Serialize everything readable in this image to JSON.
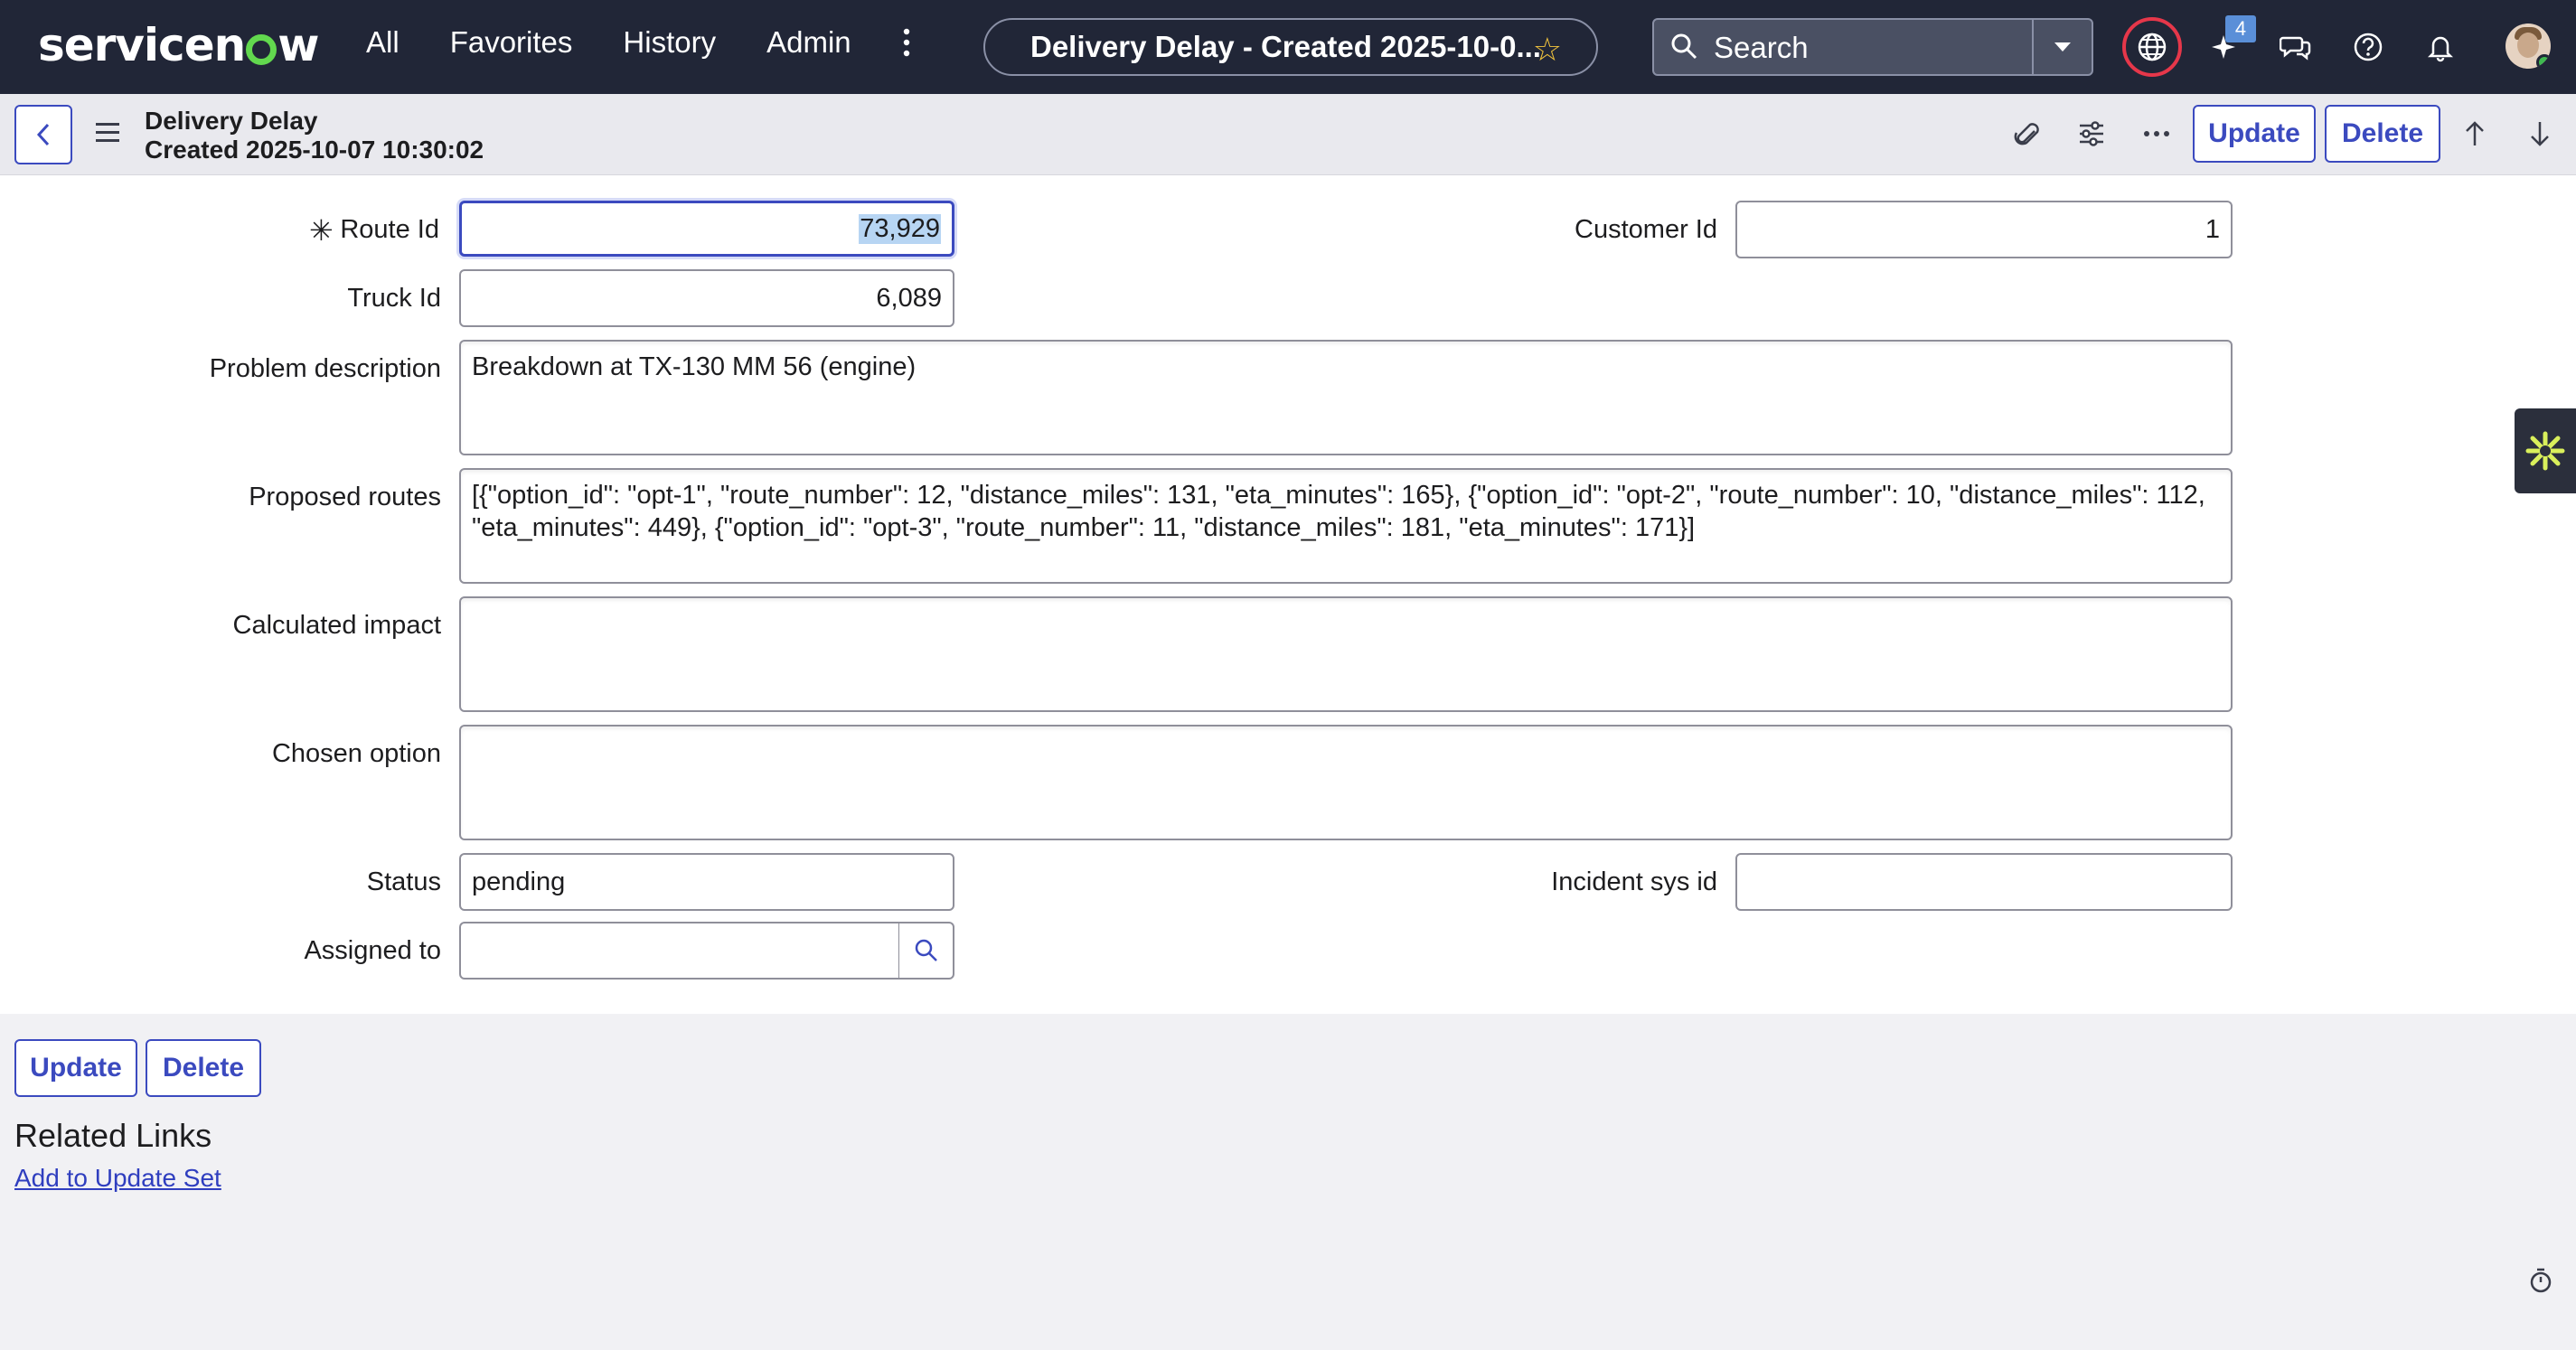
{
  "nav": {
    "logo_text": "servicenow",
    "menu": [
      "All",
      "Favorites",
      "History",
      "Admin"
    ],
    "record_title": "Delivery Delay - Created 2025-10-0...",
    "search_placeholder": "Search",
    "notifications_badge": "4",
    "icons": [
      "more-vertical-icon",
      "star-icon",
      "search-icon",
      "chevron-down-icon",
      "globe-icon",
      "sparkle-icon",
      "chat-icon",
      "help-icon",
      "bell-icon",
      "avatar"
    ]
  },
  "header": {
    "title_line1": "Delivery Delay",
    "title_line2": "Created 2025-10-07 10:30:02",
    "update_label": "Update",
    "delete_label": "Delete",
    "icons": [
      "back-icon",
      "menu-icon",
      "paperclip-icon",
      "settings-sliders-icon",
      "more-horizontal-icon",
      "arrow-up-icon",
      "arrow-down-icon"
    ]
  },
  "form": {
    "route_id": {
      "label": "Route Id",
      "value": "73,929",
      "required": true
    },
    "customer_id": {
      "label": "Customer Id",
      "value": "1"
    },
    "truck_id": {
      "label": "Truck Id",
      "value": "6,089"
    },
    "problem_description": {
      "label": "Problem description",
      "value": "Breakdown at TX-130 MM 56 (engine)"
    },
    "proposed_routes": {
      "label": "Proposed routes",
      "value": "[{\"option_id\": \"opt-1\", \"route_number\": 12, \"distance_miles\": 131, \"eta_minutes\": 165}, {\"option_id\": \"opt-2\", \"route_number\": 10, \"distance_miles\": 112, \"eta_minutes\": 449}, {\"option_id\": \"opt-3\", \"route_number\": 11, \"distance_miles\": 181, \"eta_minutes\": 171}]"
    },
    "calculated_impact": {
      "label": "Calculated impact",
      "value": ""
    },
    "chosen_option": {
      "label": "Chosen option",
      "value": ""
    },
    "status": {
      "label": "Status",
      "value": "pending"
    },
    "incident_sys_id": {
      "label": "Incident sys id",
      "value": ""
    },
    "assigned_to": {
      "label": "Assigned to",
      "value": ""
    }
  },
  "footer": {
    "update_label": "Update",
    "delete_label": "Delete",
    "related_links_title": "Related Links",
    "related_links": [
      "Add to Update Set"
    ]
  },
  "colors": {
    "nav_bg": "#212637",
    "accent": "#3b4abf",
    "logo_green": "#62d84e",
    "alert_red": "#e6374a",
    "badge_blue": "#5a8fd8"
  }
}
